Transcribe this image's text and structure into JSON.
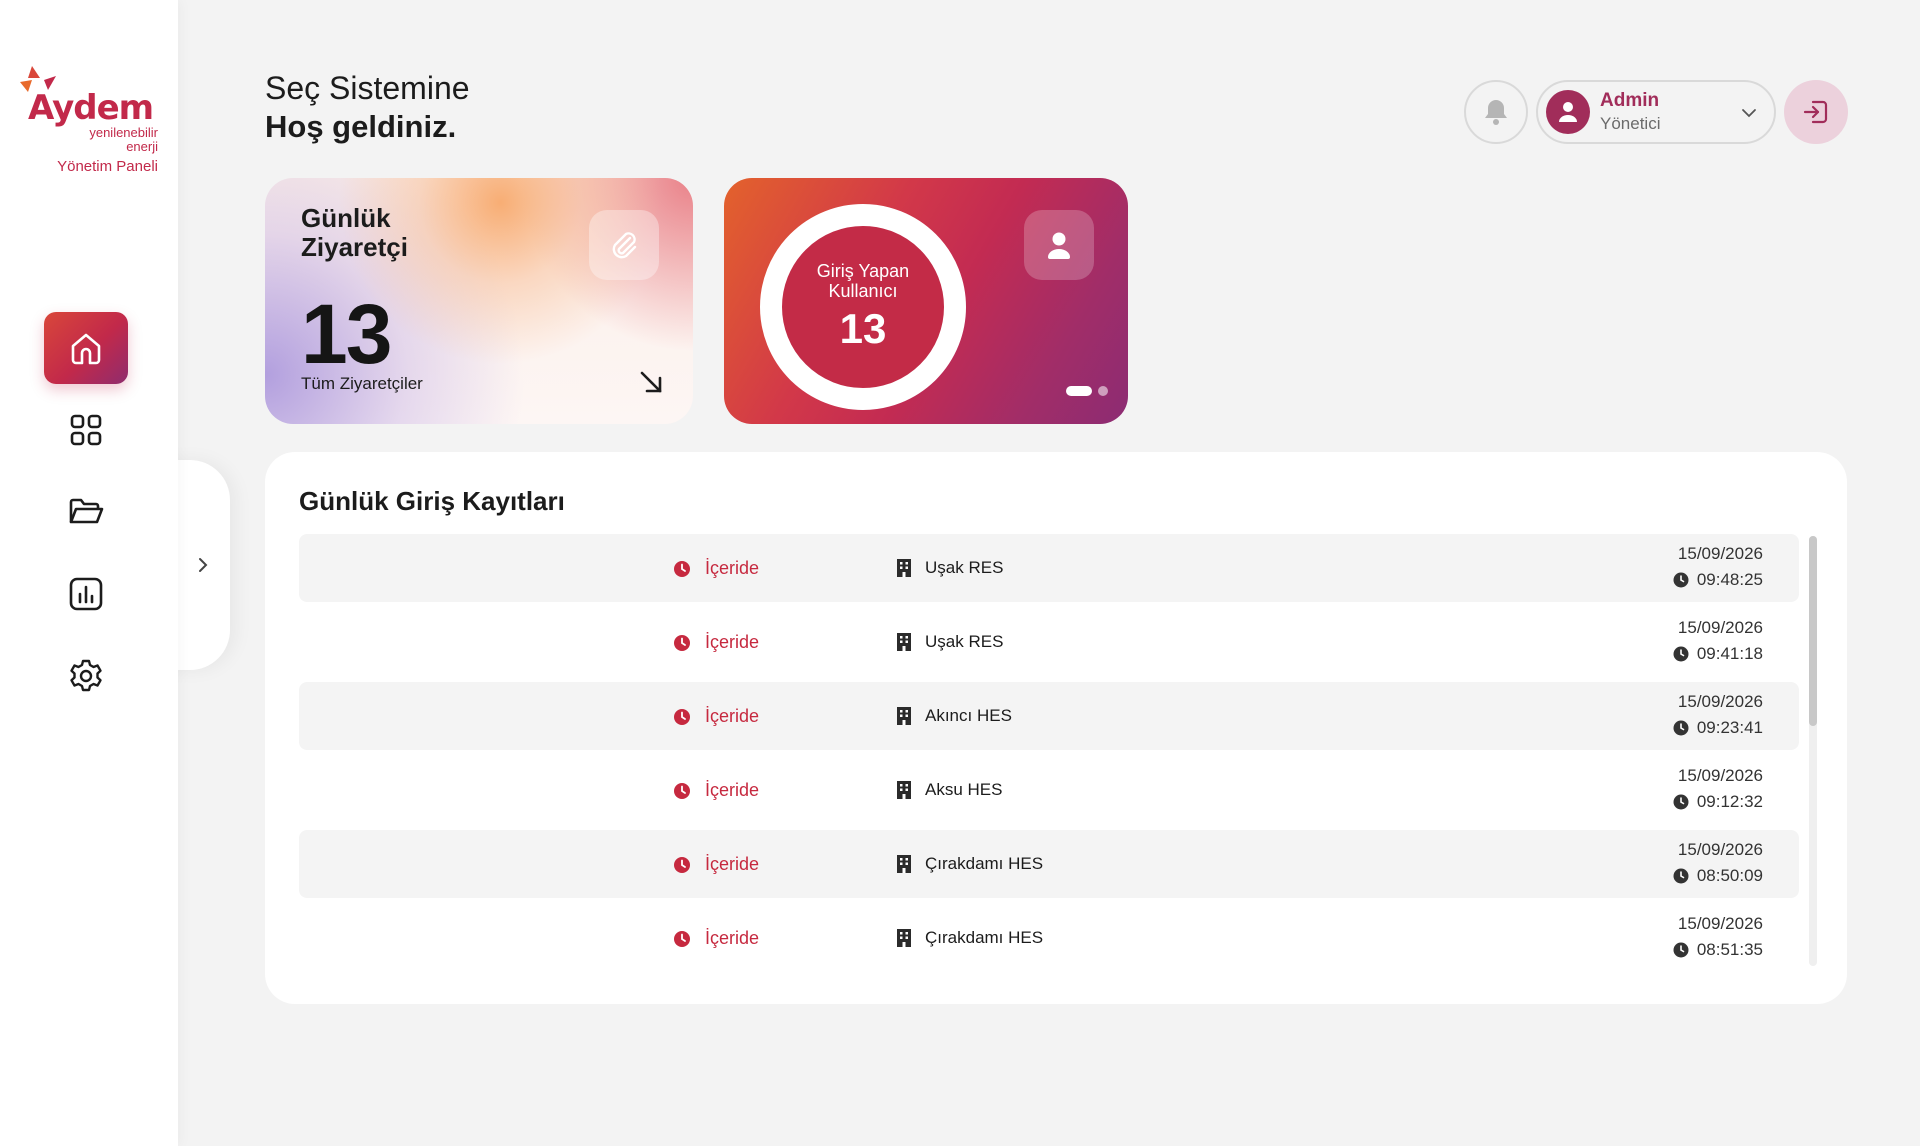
{
  "brand": {
    "name": "Aydem",
    "tagline_line1": "yenilenebilir",
    "tagline_line2": "enerji",
    "panel_name": "Yönetim Paneli",
    "accent": "#c2294a"
  },
  "sidebar": {
    "items": [
      {
        "name": "home",
        "icon": "home-icon",
        "active": true
      },
      {
        "name": "dashboard",
        "icon": "grid-icon",
        "active": false
      },
      {
        "name": "files",
        "icon": "folder-icon",
        "active": false
      },
      {
        "name": "reports",
        "icon": "chart-icon",
        "active": false
      },
      {
        "name": "settings",
        "icon": "gear-icon",
        "active": false
      }
    ],
    "collapse_icon": "chevron-right-icon"
  },
  "header": {
    "line1": "Seç Sistemine",
    "line2": "Hoş geldiniz."
  },
  "user": {
    "name": "Admin",
    "role": "Yönetici",
    "avatar_icon": "user-icon",
    "notification_icon": "bell-icon",
    "logout_icon": "logout-icon"
  },
  "visitor_card": {
    "title_line1": "Günlük",
    "title_line2": "Ziyaretçi",
    "count": "13",
    "link_label": "Tüm Ziyaretçiler",
    "icon": "paperclip-icon",
    "arrow_icon": "arrow-down-right-icon"
  },
  "users_card": {
    "label_line1": "Giriş Yapan",
    "label_line2": "Kullanıcı",
    "count": "13",
    "icon": "user-icon",
    "carousel_pages": 2,
    "carousel_active": 1
  },
  "logs": {
    "title": "Günlük Giriş Kayıtları",
    "rows": [
      {
        "status": "İçeride",
        "site": "Uşak RES",
        "date": "15/09/2026",
        "time": "09:48:25"
      },
      {
        "status": "İçeride",
        "site": "Uşak RES",
        "date": "15/09/2026",
        "time": "09:41:18"
      },
      {
        "status": "İçeride",
        "site": "Akıncı HES",
        "date": "15/09/2026",
        "time": "09:23:41"
      },
      {
        "status": "İçeride",
        "site": "Aksu HES",
        "date": "15/09/2026",
        "time": "09:12:32"
      },
      {
        "status": "İçeride",
        "site": "Çırakdamı HES",
        "date": "15/09/2026",
        "time": "08:50:09"
      },
      {
        "status": "İçeride",
        "site": "Çırakdamı HES",
        "date": "15/09/2026",
        "time": "08:51:35"
      }
    ]
  }
}
